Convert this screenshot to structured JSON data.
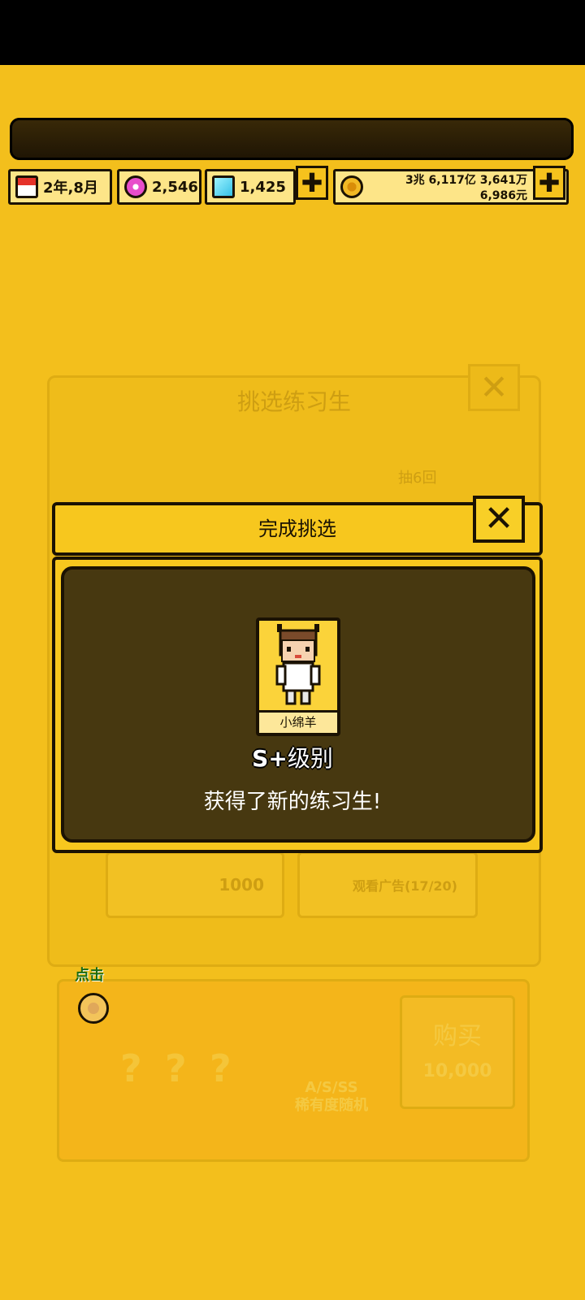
{
  "resources": {
    "date": "2年,8月",
    "pink_gems": "2,546",
    "cyan_gems": "1,425",
    "money_line1": "3兆 6,117亿 3,641万",
    "money_line2": "6,986元",
    "plus": "✚"
  },
  "background_panel": {
    "title": "挑选练习生",
    "close": "✕",
    "draw_label": "抽6回",
    "btn_cost": "1000",
    "btn_ad": "观看广告(17/20)",
    "unknown": "?",
    "rarity_random": "A/S/SS\n稀有度随机",
    "buy_label": "购买",
    "buy_cost": "10,000"
  },
  "hint": {
    "click_label": "点击"
  },
  "modal": {
    "title": "完成挑选",
    "close": "✕",
    "trainee_name": "小绵羊",
    "grade": "S+",
    "grade_suffix": "级别",
    "message": "获得了新的练习生!"
  },
  "colors": {
    "background": "#f3bf1c",
    "modal_inner": "#473810",
    "outline": "#1b1203"
  }
}
